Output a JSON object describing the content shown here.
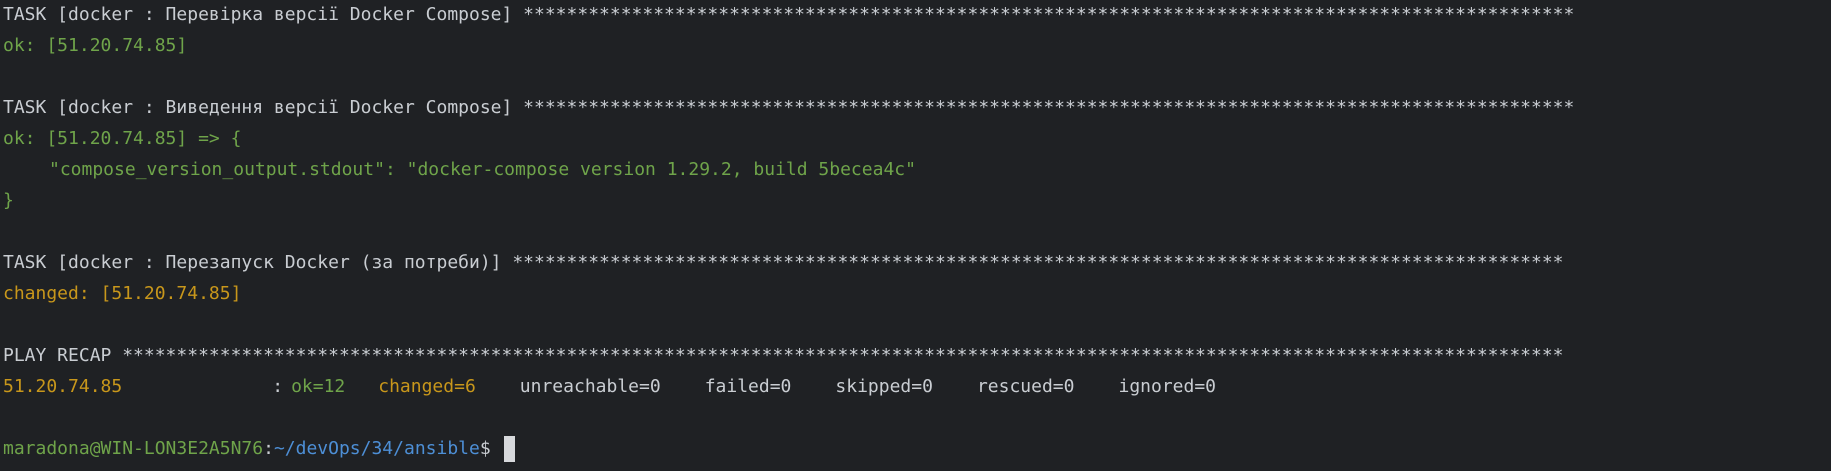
{
  "terminal": {
    "lines": [
      "TASK [docker : Перевірка версії Docker Compose] *************************************************************************************************",
      "ok: [51.20.74.85]",
      "",
      "TASK [docker : Виведення версії Docker Compose] *************************************************************************************************",
      "ok: [51.20.74.85] => {",
      "\"compose_version_output.stdout\": \"docker-compose version 1.29.2, build 5becea4c\"",
      "}",
      "",
      "TASK [docker : Перезапуск Docker (за потреби)] *************************************************************************************************",
      "changed: [51.20.74.85]",
      "",
      "PLAY RECAP *************************************************************************************************************************************"
    ],
    "recap": {
      "host": "51.20.74.85",
      "colon": ":",
      "ok": "ok=12",
      "changed": "changed=6",
      "unreachable": "unreachable=0",
      "failed": "failed=0",
      "skipped": "skipped=0",
      "rescued": "rescued=0",
      "ignored": "ignored=0"
    },
    "prompt": {
      "user_host": "maradona@WIN-LON3E2A5N76",
      "separator": ":",
      "path": "~/devOps/34/ansible",
      "symbol": "$ "
    }
  },
  "colors": {
    "background": "#1f2124",
    "ok": "#6fa44a",
    "changed": "#c8971b",
    "path": "#4d8fd6",
    "text": "#c9cdd2"
  }
}
